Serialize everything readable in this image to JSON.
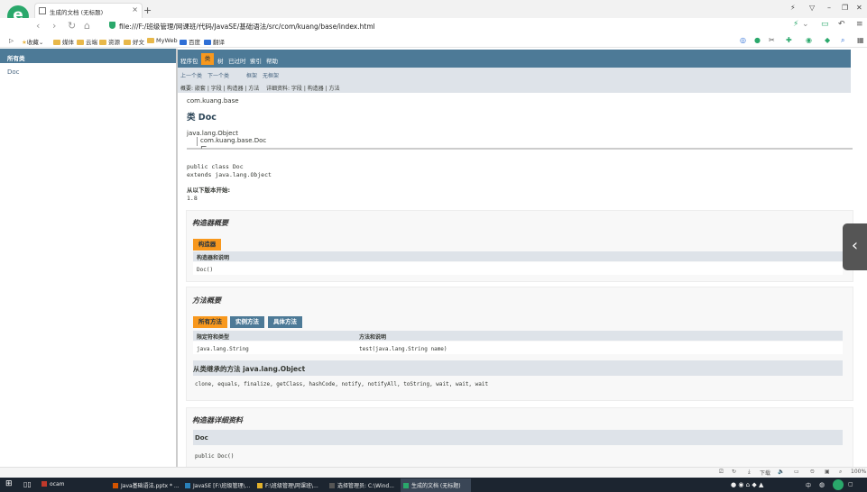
{
  "browser": {
    "tab_title": "生成的文档 (无标题)",
    "new_tab": "+",
    "url": "file:///F:/班级管理/网课班/代码/JavaSE/基础语法/src/com/kuang/base/index.html",
    "logo_letter": "e",
    "accent": "#2aa86b"
  },
  "bookmarks": [
    "收藏",
    "媒体",
    "云端",
    "资源",
    "好文",
    "MyWeb",
    "百度",
    "翻译"
  ],
  "left_frame": {
    "header": "所有类",
    "items": [
      "Doc"
    ]
  },
  "javadoc": {
    "nav": [
      "程序包",
      "类",
      "树",
      "已过时",
      "索引",
      "帮助"
    ],
    "subnav": {
      "prev": "上一个类",
      "next": "下一个类",
      "frames": "框架",
      "noframes": "无框架",
      "summary_line": "概要: 嵌套 | 字段 | 构造器 | 方法",
      "detail_line": "详细资料: 字段 | 构造器 | 方法"
    },
    "package": "com.kuang.base",
    "class_title": "类 Doc",
    "inheritance": [
      "java.lang.Object",
      "com.kuang.base.Doc"
    ],
    "declaration": [
      "public class Doc",
      "extends java.lang.Object"
    ],
    "since_label": "从以下版本开始:",
    "since_value": "1.8",
    "constructor_summary": {
      "title": "构造器概要",
      "tab": "构造器",
      "header": "构造器和说明",
      "row": "Doc()"
    },
    "method_summary": {
      "title": "方法概要",
      "tabs": [
        "所有方法",
        "实例方法",
        "具体方法"
      ],
      "col1": "限定符和类型",
      "col2": "方法和说明",
      "row_type": "java.lang.String",
      "row_method": "test(java.lang.String name)",
      "inherited_title": "从类继承的方法 java.lang.Object",
      "inherited_list": "clone, equals, finalize, getClass, hashCode, notify, notifyAll, toString, wait, wait, wait"
    },
    "constructor_detail": {
      "title": "构造器详细资料",
      "name": "Doc",
      "signature": "public Doc()"
    }
  },
  "status": {
    "download": "下载",
    "zoom": "100%"
  },
  "taskbar": [
    {
      "label": "ocam",
      "color": "#c0392b"
    },
    {
      "label": "Java基础语法.pptx * ...",
      "color": "#d35400"
    },
    {
      "label": "JavaSE [F:\\班级管理\\...",
      "color": "#2980b9"
    },
    {
      "label": "F:\\班级管理\\网课班\\...",
      "color": "#e1b12c"
    },
    {
      "label": "选择管理员: C:\\Wind...",
      "color": "#555555"
    },
    {
      "label": "生成的文档 (无标题)",
      "color": "#2aa86b"
    }
  ],
  "tray_lang": "中"
}
